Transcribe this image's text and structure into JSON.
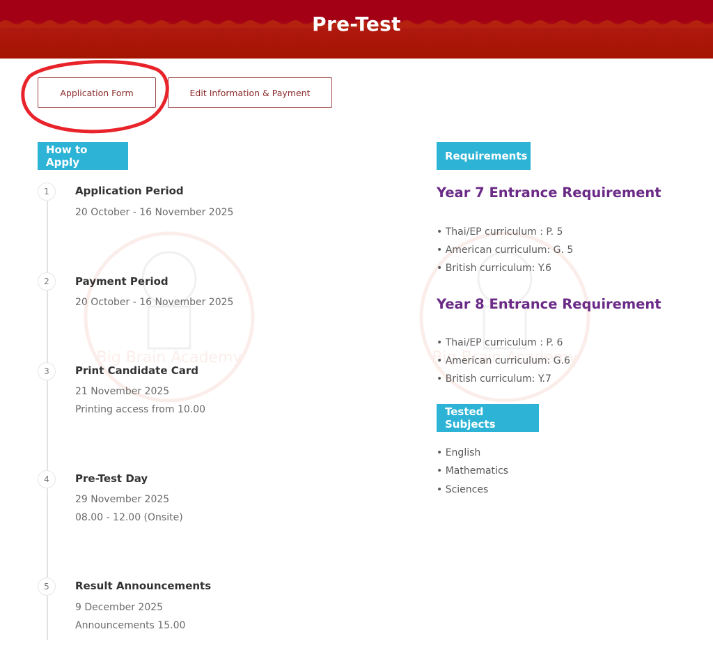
{
  "header": {
    "title": "Pre-Test"
  },
  "tabs": {
    "application_form": "Application Form",
    "edit_info_payment": "Edit Information & Payment"
  },
  "how_to_apply": {
    "heading": "How to Apply",
    "steps": [
      {
        "number": "1",
        "title": "Application Period",
        "lines": [
          "20 October - 16 November 2025"
        ]
      },
      {
        "number": "2",
        "title": "Payment Period",
        "lines": [
          "20 October - 16 November 2025"
        ]
      },
      {
        "number": "3",
        "title": "Print Candidate Card",
        "lines": [
          "21 November 2025",
          "Printing access from 10.00"
        ]
      },
      {
        "number": "4",
        "title": "Pre-Test Day",
        "lines": [
          "29 November 2025",
          "08.00 - 12.00 (Onsite)"
        ]
      },
      {
        "number": "5",
        "title": "Result Announcements",
        "lines": [
          "9 December 2025",
          "Announcements 15.00"
        ]
      }
    ]
  },
  "requirements": {
    "heading": "Requirements",
    "groups": [
      {
        "title": "Year 7 Entrance Requirement",
        "items": [
          "• Thai/EP curriculum : P. 5",
          "• American curriculum: G. 5",
          "• British curriculum: Y.6"
        ]
      },
      {
        "title": "Year 8 Entrance Requirement",
        "items": [
          "• Thai/EP curriculum : P. 6",
          "• American curriculum: G.6",
          "• British curriculum: Y.7"
        ]
      }
    ]
  },
  "tested_subjects": {
    "heading": "Tested Subjects",
    "items": [
      "• English",
      "• Mathematics",
      "• Sciences"
    ]
  },
  "watermark": {
    "text": "Big Brain Academy"
  },
  "colors": {
    "banner": "#a30016",
    "badge": "#2cb3d6",
    "requirement_title": "#6a2a86",
    "annotation_circle": "#e8232a"
  }
}
